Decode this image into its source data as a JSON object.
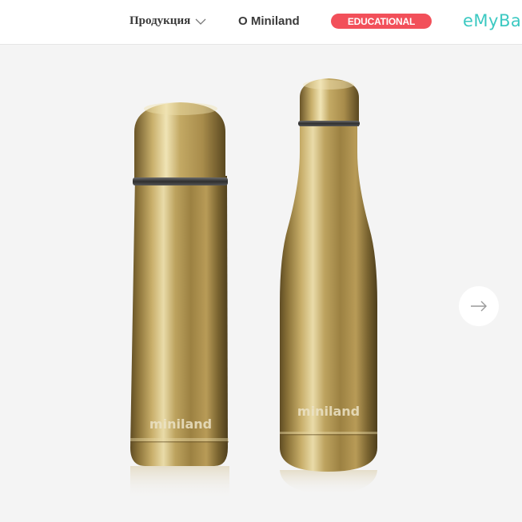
{
  "header": {
    "nav": {
      "products_label": "Продукция",
      "about_label": "O Miniland",
      "educational_label": "EDUCATIONAL",
      "brand_label": "eMyBab"
    }
  },
  "hero": {
    "thermos_logo": "miniland",
    "bottle_logo": "miniland"
  },
  "colors": {
    "accent_red": "#f2505a",
    "brand_teal": "#3cc9c2",
    "gold": "#b79a52"
  },
  "icons": [
    "chevron-down-icon",
    "arrow-right-icon"
  ]
}
